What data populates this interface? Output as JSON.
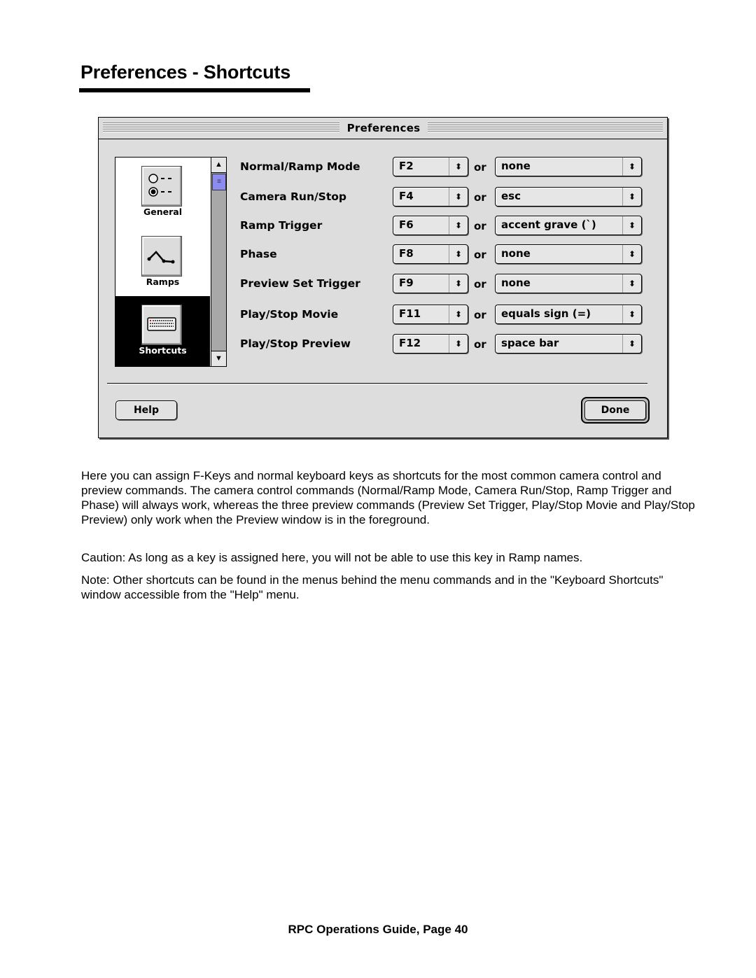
{
  "page": {
    "title": "Preferences - Shortcuts",
    "footer": "RPC Operations Guide, Page 40"
  },
  "window": {
    "title": "Preferences",
    "panes": [
      {
        "label": "General",
        "icon": "radio-buttons-icon",
        "selected": false
      },
      {
        "label": "Ramps",
        "icon": "ramp-curve-icon",
        "selected": false
      },
      {
        "label": "Shortcuts",
        "icon": "keyboard-icon",
        "selected": true
      }
    ],
    "scrollbar": {
      "up_icon": "▲",
      "down_icon": "▼",
      "thumb_icon": "≡"
    },
    "or_label": "or",
    "popup_arrows": "⬍",
    "shortcuts": [
      {
        "label": "Normal/Ramp Mode",
        "fkey": "F2",
        "alt": "none"
      },
      {
        "label": "Camera Run/Stop",
        "fkey": "F4",
        "alt": "esc"
      },
      {
        "label": "Ramp Trigger",
        "fkey": "F6",
        "alt": "accent grave (`)"
      },
      {
        "label": "Phase",
        "fkey": "F8",
        "alt": "none"
      },
      {
        "label": "Preview Set Trigger",
        "fkey": "F9",
        "alt": "none"
      },
      {
        "label": "Play/Stop Movie",
        "fkey": "F11",
        "alt": "equals sign (=)"
      },
      {
        "label": "Play/Stop Preview",
        "fkey": "F12",
        "alt": "space bar"
      }
    ],
    "buttons": {
      "help": "Help",
      "done": "Done"
    }
  },
  "body": {
    "paragraphs": [
      "Here you can assign F-Keys and normal keyboard keys as shortcuts for the most common camera control and preview commands. The camera control commands (Normal/Ramp Mode, Camera Run/Stop, Ramp Trigger and Phase) will always work, whereas the three preview commands (Preview Set Trigger, Play/Stop Movie and Play/Stop Preview) only work when the Preview window is in the foreground.",
      "Caution: As long as a key is assigned here, you will not be able to use this key in Ramp names.",
      "Note: Other shortcuts can be found in the menus behind the menu commands and in the \"Keyboard Shortcuts\" window accessible from the \"Help\" menu."
    ]
  }
}
